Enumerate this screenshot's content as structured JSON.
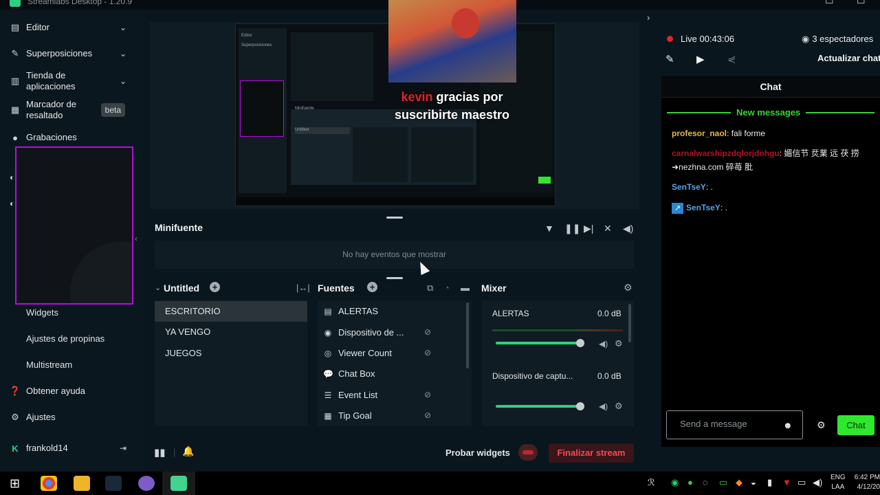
{
  "app": {
    "title": "Streamlabs Desktop - 1.20.9"
  },
  "sidebar": {
    "items": [
      {
        "label": "Editor",
        "icon": "editor-icon"
      },
      {
        "label": "Superposiciones",
        "icon": "overlays-icon"
      },
      {
        "label": "Tienda de aplicaciones",
        "icon": "store-icon"
      },
      {
        "label": "Marcador de resaltado",
        "icon": "highlighter-icon",
        "badge": "beta"
      },
      {
        "label": "Grabaciones",
        "icon": "recordings-icon"
      }
    ],
    "sub_items": [
      "Widgets",
      "Ajustes de propinas",
      "Multistream"
    ],
    "help_label": "Obtener ayuda",
    "settings_label": "Ajustes",
    "user_label": "frankold14"
  },
  "stage": {
    "alert_username": "kevin",
    "alert_message": "gracias por suscribirte maestro"
  },
  "minifuente": {
    "title": "Minifuente",
    "empty_text": "No hay eventos que mostrar"
  },
  "scenes": {
    "title": "Untitled",
    "items": [
      "ESCRITORIO",
      "YA VENGO",
      "JUEGOS"
    ],
    "active_index": 0
  },
  "sources": {
    "title": "Fuentes",
    "items": [
      {
        "label": "ALERTAS",
        "icon": "folder-icon",
        "hidden": false
      },
      {
        "label": "Dispositivo de ...",
        "icon": "webcam-icon",
        "hidden": true
      },
      {
        "label": "Viewer Count",
        "icon": "eye-icon",
        "hidden": true
      },
      {
        "label": "Chat Box",
        "icon": "chat-icon",
        "hidden": false
      },
      {
        "label": "Event List",
        "icon": "list-icon",
        "hidden": true
      },
      {
        "label": "Tip Goal",
        "icon": "calendar-icon",
        "hidden": true
      }
    ]
  },
  "mixer": {
    "title": "Mixer",
    "channels": [
      {
        "name": "ALERTAS",
        "db": "0.0 dB",
        "level": 1.0
      },
      {
        "name": "Dispositivo de captu...",
        "db": "0.0 dB",
        "level": 1.0
      }
    ]
  },
  "footer": {
    "test_widgets_label": "Probar widgets",
    "end_stream_label": "Finalizar stream"
  },
  "chat_panel": {
    "live_label": "Live 00:43:06",
    "viewers_label": "3 espectadores",
    "refresh_label": "Actualizar chat",
    "header": "Chat",
    "new_messages_label": "New messages",
    "messages": [
      {
        "user": "profesor_naol",
        "text": " fali forme"
      },
      {
        "user": "carnalwarshipzdqlorjdohgu",
        "text": " 媚信节 烎業 远 茯 捞 ➜nezhna.com 碎苺 肶"
      },
      {
        "user": "SenTseY",
        "text": " ."
      },
      {
        "user": "SenTseY",
        "text": " ."
      }
    ],
    "input_placeholder": "Send a message",
    "send_label": "Chat"
  },
  "taskbar": {
    "lang_line1": "ENG",
    "lang_line2": "LAA",
    "time": "6:42 PM",
    "date": "4/12/20"
  },
  "colors": {
    "accent_green": "#2ecf84",
    "chat_green": "#3bd23b",
    "live_red": "#e0252b",
    "preview_border": "#b40ddb"
  }
}
